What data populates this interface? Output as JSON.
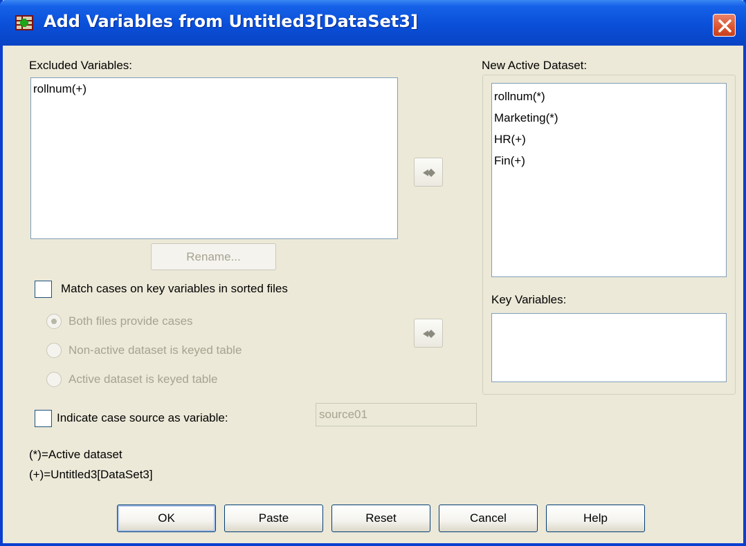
{
  "window": {
    "title": "Add Variables from Untitled3[DataSet3]",
    "accent_color": "#0a4fd8",
    "close_icon": "close-icon"
  },
  "excluded": {
    "label": "Excluded Variables:",
    "items": [
      "rollnum(+)"
    ]
  },
  "rename_button": "Rename...",
  "new_active": {
    "label": "New Active Dataset:",
    "items": [
      "rollnum(*)",
      "Marketing(*)",
      "HR(+)",
      "Fin(+)"
    ]
  },
  "key_variables": {
    "label": "Key Variables:",
    "items": []
  },
  "match_cases": {
    "label": "Match cases on key variables in sorted files",
    "checked": false
  },
  "radios": [
    {
      "label": "Both files provide cases",
      "selected": true
    },
    {
      "label": "Non-active dataset is keyed table",
      "selected": false
    },
    {
      "label": "Active dataset is keyed table",
      "selected": false
    }
  ],
  "case_source": {
    "label": "Indicate case source as variable:",
    "checked": false,
    "value": "source01"
  },
  "legend": {
    "active": "(*)=Active dataset",
    "other": "(+)=Untitled3[DataSet3]"
  },
  "buttons": {
    "ok": "OK",
    "paste": "Paste",
    "reset": "Reset",
    "cancel": "Cancel",
    "help": "Help"
  },
  "icons": [
    "app-icon",
    "close-icon",
    "arrow-right-icon"
  ]
}
